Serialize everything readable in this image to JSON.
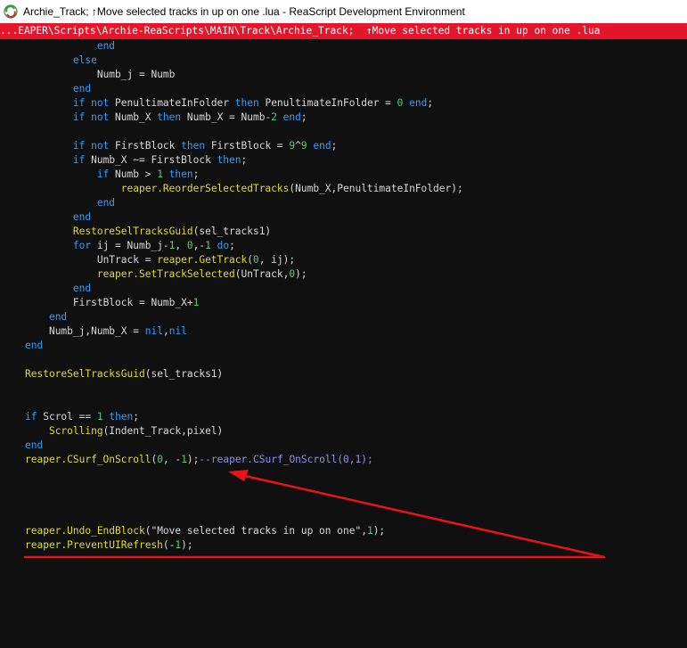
{
  "window": {
    "title": "Archie_Track;  ↑Move selected tracks in up on one .lua - ReaScript Development Environment"
  },
  "path_bar": {
    "text": "...EAPER\\Scripts\\Archie-ReaScripts\\MAIN\\Track\\Archie_Track;  ↑Move selected tracks in up on one .lua"
  },
  "colors": {
    "keyword": "#2f9fff",
    "function": "#e0dc2c",
    "identifier": "#d8d8d8",
    "number": "#50d070",
    "comment": "#8e8ee8",
    "path_bar_bg": "#e4162c",
    "editor_bg": "#101010",
    "annotation": "#e8141a"
  },
  "icons": {
    "app": "reaper-app-icon"
  },
  "code": {
    "lines": [
      [
        {
          "t": "            "
        },
        {
          "c": "kw",
          "t": "end"
        }
      ],
      [
        {
          "t": "        "
        },
        {
          "c": "kw",
          "t": "else"
        }
      ],
      [
        {
          "t": "            "
        },
        {
          "c": "id",
          "t": "Numb_j = Numb"
        }
      ],
      [
        {
          "t": "        "
        },
        {
          "c": "kw",
          "t": "end"
        }
      ],
      [
        {
          "t": "        "
        },
        {
          "c": "kw",
          "t": "if not "
        },
        {
          "c": "id",
          "t": "PenultimateInFolder "
        },
        {
          "c": "kw",
          "t": "then "
        },
        {
          "c": "id",
          "t": "PenultimateInFolder = "
        },
        {
          "c": "num",
          "t": "0"
        },
        {
          "c": "kw",
          "t": " end"
        },
        {
          "c": "id",
          "t": ";"
        }
      ],
      [
        {
          "t": "        "
        },
        {
          "c": "kw",
          "t": "if not "
        },
        {
          "c": "id",
          "t": "Numb_X "
        },
        {
          "c": "kw",
          "t": "then "
        },
        {
          "c": "id",
          "t": "Numb_X = Numb-"
        },
        {
          "c": "num",
          "t": "2"
        },
        {
          "c": "kw",
          "t": " end"
        },
        {
          "c": "id",
          "t": ";"
        }
      ],
      [
        {
          "t": ""
        }
      ],
      [
        {
          "t": "        "
        },
        {
          "c": "kw",
          "t": "if not "
        },
        {
          "c": "id",
          "t": "FirstBlock "
        },
        {
          "c": "kw",
          "t": "then "
        },
        {
          "c": "id",
          "t": "FirstBlock = "
        },
        {
          "c": "num",
          "t": "9"
        },
        {
          "c": "id",
          "t": "^"
        },
        {
          "c": "num",
          "t": "9"
        },
        {
          "c": "kw",
          "t": " end"
        },
        {
          "c": "id",
          "t": ";"
        }
      ],
      [
        {
          "t": "        "
        },
        {
          "c": "kw",
          "t": "if "
        },
        {
          "c": "id",
          "t": "Numb_X ~= FirstBlock "
        },
        {
          "c": "kw",
          "t": "then"
        },
        {
          "c": "id",
          "t": ";"
        }
      ],
      [
        {
          "t": "            "
        },
        {
          "c": "kw",
          "t": "if "
        },
        {
          "c": "id",
          "t": "Numb > "
        },
        {
          "c": "num",
          "t": "1"
        },
        {
          "c": "kw",
          "t": " then"
        },
        {
          "c": "id",
          "t": ";"
        }
      ],
      [
        {
          "t": "                "
        },
        {
          "c": "fn",
          "t": "reaper.ReorderSelectedTracks"
        },
        {
          "c": "id",
          "t": "(Numb_X,PenultimateInFolder);"
        }
      ],
      [
        {
          "t": "            "
        },
        {
          "c": "kw",
          "t": "end"
        }
      ],
      [
        {
          "t": "        "
        },
        {
          "c": "kw",
          "t": "end"
        }
      ],
      [
        {
          "t": "        "
        },
        {
          "c": "fn",
          "t": "RestoreSelTracksGuid"
        },
        {
          "c": "id",
          "t": "(sel_tracks1)"
        }
      ],
      [
        {
          "t": "        "
        },
        {
          "c": "kw",
          "t": "for "
        },
        {
          "c": "id",
          "t": "ij = Numb_j-"
        },
        {
          "c": "num",
          "t": "1"
        },
        {
          "c": "id",
          "t": ", "
        },
        {
          "c": "num",
          "t": "0"
        },
        {
          "c": "id",
          "t": ",-"
        },
        {
          "c": "num",
          "t": "1"
        },
        {
          "c": "kw",
          "t": " do"
        },
        {
          "c": "id",
          "t": ";"
        }
      ],
      [
        {
          "t": "            "
        },
        {
          "c": "id",
          "t": "UnTrack = "
        },
        {
          "c": "fn",
          "t": "reaper.GetTrack"
        },
        {
          "c": "id",
          "t": "("
        },
        {
          "c": "num",
          "t": "0"
        },
        {
          "c": "id",
          "t": ", ij);"
        }
      ],
      [
        {
          "t": "            "
        },
        {
          "c": "fn",
          "t": "reaper.SetTrackSelected"
        },
        {
          "c": "id",
          "t": "(UnTrack,"
        },
        {
          "c": "num",
          "t": "0"
        },
        {
          "c": "id",
          "t": ");"
        }
      ],
      [
        {
          "t": "        "
        },
        {
          "c": "kw",
          "t": "end"
        }
      ],
      [
        {
          "t": "        "
        },
        {
          "c": "id",
          "t": "FirstBlock = Numb_X+"
        },
        {
          "c": "num",
          "t": "1"
        }
      ],
      [
        {
          "t": "    "
        },
        {
          "c": "kw",
          "t": "end"
        }
      ],
      [
        {
          "t": "    "
        },
        {
          "c": "id",
          "t": "Numb_j,Numb_X = "
        },
        {
          "c": "kw",
          "t": "nil"
        },
        {
          "c": "id",
          "t": ","
        },
        {
          "c": "kw",
          "t": "nil"
        }
      ],
      [
        {
          "c": "kw",
          "t": "end"
        }
      ],
      [
        {
          "t": ""
        }
      ],
      [
        {
          "c": "fn",
          "t": "RestoreSelTracksGuid"
        },
        {
          "c": "id",
          "t": "(sel_tracks1)"
        }
      ],
      [
        {
          "t": ""
        }
      ],
      [
        {
          "t": ""
        }
      ],
      [
        {
          "c": "kw",
          "t": "if "
        },
        {
          "c": "id",
          "t": "Scrol == "
        },
        {
          "c": "num",
          "t": "1"
        },
        {
          "c": "kw",
          "t": " then"
        },
        {
          "c": "id",
          "t": ";"
        }
      ],
      [
        {
          "t": "    "
        },
        {
          "c": "fn",
          "t": "Scrolling"
        },
        {
          "c": "id",
          "t": "(Indent_Track,pixel)"
        }
      ],
      [
        {
          "c": "kw",
          "t": "end"
        }
      ],
      [
        {
          "c": "fn",
          "t": "reaper.CSurf_OnScroll"
        },
        {
          "c": "id",
          "t": "("
        },
        {
          "c": "num",
          "t": "0"
        },
        {
          "c": "id",
          "t": ", -"
        },
        {
          "c": "num",
          "t": "1"
        },
        {
          "c": "id",
          "t": ");"
        },
        {
          "c": "cmt",
          "t": "--reaper.CSurf_OnScroll(0,1);"
        }
      ],
      [
        {
          "t": ""
        }
      ],
      [
        {
          "t": ""
        }
      ],
      [
        {
          "t": ""
        }
      ],
      [
        {
          "t": ""
        }
      ],
      [
        {
          "c": "fn",
          "t": "reaper.Undo_EndBlock"
        },
        {
          "c": "id",
          "t": "(\"Move selected tracks in up on one\","
        },
        {
          "c": "num",
          "t": "1"
        },
        {
          "c": "id",
          "t": ");"
        }
      ],
      [
        {
          "c": "fn",
          "t": "reaper.PreventUIRefresh"
        },
        {
          "c": "id",
          "t": "(-"
        },
        {
          "c": "num",
          "t": "1"
        },
        {
          "c": "id",
          "t": ");"
        }
      ]
    ]
  }
}
